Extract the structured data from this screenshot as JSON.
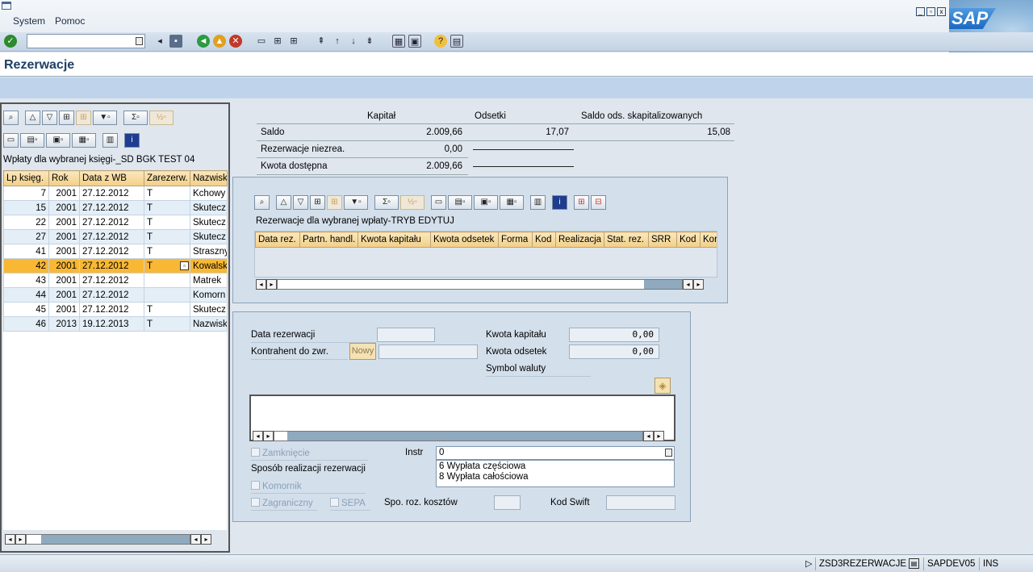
{
  "menu": {
    "items": [
      "System",
      "Pomoc"
    ]
  },
  "title": "Rezerwacje",
  "left": {
    "caption": "Wpłaty dla wybranej księgi-_SD BGK TEST 04",
    "columns": [
      "Lp księg.",
      "Rok",
      "Data z WB",
      "Zarezerw.",
      "Nazwisk"
    ],
    "rows": [
      [
        "7",
        "2001",
        "27.12.2012",
        "T",
        "Kchowy"
      ],
      [
        "15",
        "2001",
        "27.12.2012",
        "T",
        "Skutecz"
      ],
      [
        "22",
        "2001",
        "27.12.2012",
        "T",
        "Skutecz"
      ],
      [
        "27",
        "2001",
        "27.12.2012",
        "T",
        "Skutecz"
      ],
      [
        "41",
        "2001",
        "27.12.2012",
        "T",
        "Straszny"
      ],
      [
        "42",
        "2001",
        "27.12.2012",
        "T",
        "Kowalsk"
      ],
      [
        "43",
        "2001",
        "27.12.2012",
        "",
        "Matrek"
      ],
      [
        "44",
        "2001",
        "27.12.2012",
        "",
        "Komorn"
      ],
      [
        "45",
        "2001",
        "27.12.2012",
        "T",
        "Skutecz"
      ],
      [
        "46",
        "2013",
        "19.12.2013",
        "T",
        "Nazwisk"
      ]
    ]
  },
  "summary": {
    "headers": [
      "Kapitał",
      "Odsetki",
      "Saldo ods. skapitalizowanych"
    ],
    "saldo_label": "Saldo",
    "saldo_kapital": "2.009,66",
    "saldo_odsetki": "17,07",
    "saldo_skap": "15,08",
    "rez_label": "Rezerwacje niezrea.",
    "rez_kapital": "0,00",
    "kwota_label": "Kwota dostępna",
    "kwota_kapital": "2.009,66"
  },
  "reservations": {
    "caption": "Rezerwacje dla wybranej wpłaty-TRYB EDYTUJ",
    "columns": [
      "Data rez.",
      "Partn. handl.",
      "Kwota kapitału",
      "Kwota odsetek",
      "Forma",
      "Kod",
      "Realizacja",
      "Stat. rez.",
      "SRR",
      "Kod",
      "Kor"
    ]
  },
  "form": {
    "data_rez_label": "Data rezerwacji",
    "kontrahent_label": "Kontrahent do zwr.",
    "nowy_label": "Nowy",
    "kwota_kap_label": "Kwota kapitału",
    "kwota_kap_value": "0,00",
    "kwota_ods_label": "Kwota odsetek",
    "kwota_ods_value": "0,00",
    "symbol_waluty_label": "Symbol waluty",
    "zamkniecie_label": "Zamknięcie",
    "instr_label": "Instr",
    "instr_value": "0",
    "instr_options": [
      "6 Wypłata częściowa",
      "8 Wypłata całościowa"
    ],
    "sposob_label": "Sposób realizacji rezerwacji",
    "komornik_label": "Komornik",
    "zagraniczny_label": "Zagraniczny",
    "sepa_label": "SEPA",
    "spo_label": "Spo. roz. kosztów",
    "swift_label": "Kod Swift"
  },
  "status": {
    "transaction": "ZSD3REZERWACJE",
    "system": "SAPDEV05",
    "mode": "INS"
  },
  "logo_text": "SAP",
  "colors": {
    "accent": "#1e3f66",
    "selected_row": "#f9b834",
    "header_bg": "#f2cf86"
  }
}
